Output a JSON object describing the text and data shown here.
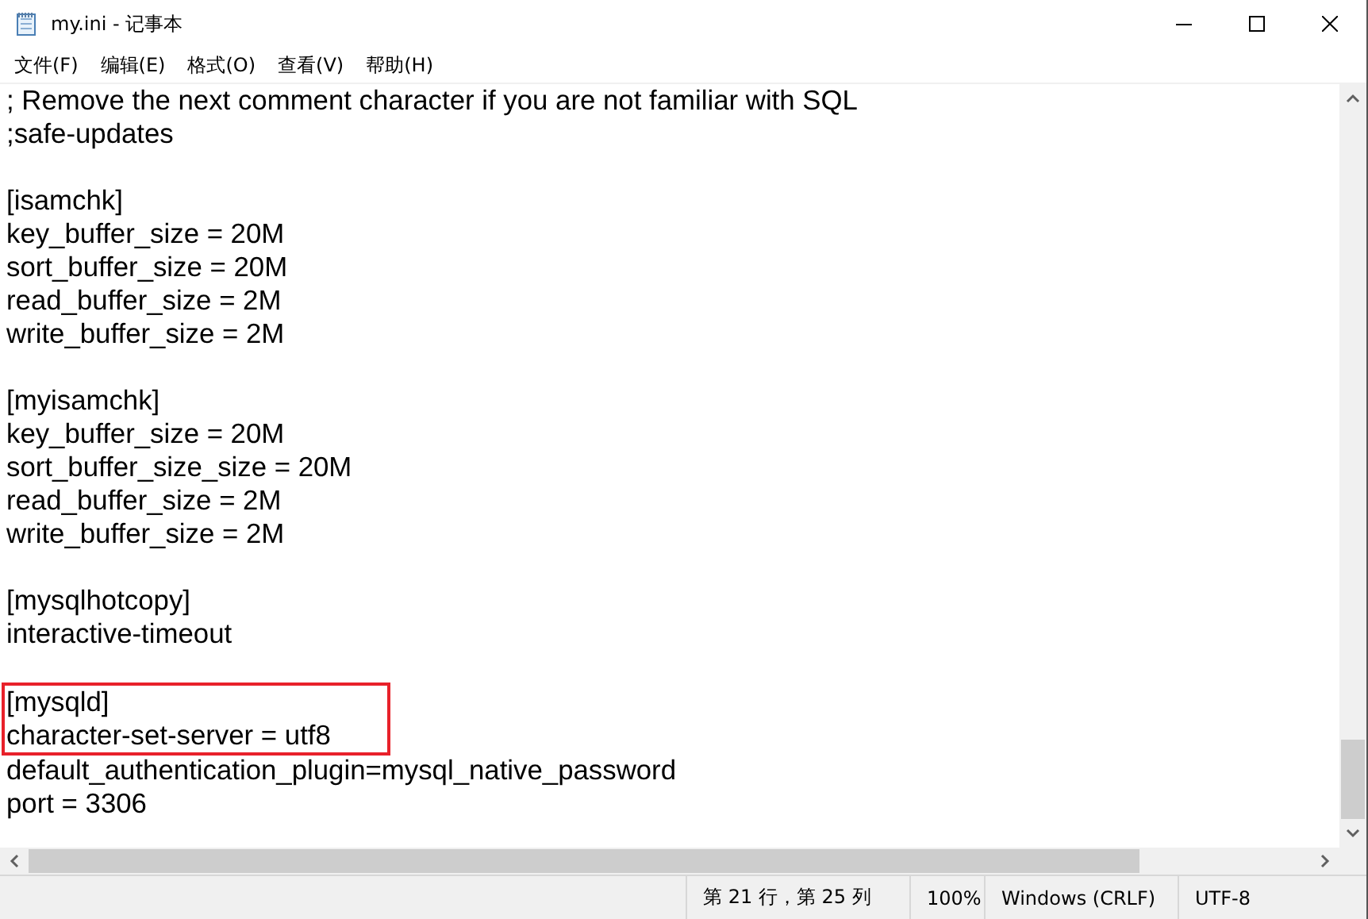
{
  "window": {
    "title": "my.ini - 记事本"
  },
  "menu": [
    "文件(F)",
    "编辑(E)",
    "格式(O)",
    "查看(V)",
    "帮助(H)"
  ],
  "lines": [
    {
      "kind": "text",
      "text": "; Remove the next comment character if you are not familiar with SQL",
      "boxed": false
    },
    {
      "kind": "text",
      "text": ";safe-updates",
      "boxed": false
    },
    {
      "kind": "blank"
    },
    {
      "kind": "text",
      "text": "[isamchk]",
      "boxed": false
    },
    {
      "kind": "text",
      "text": "key_buffer_size = 20M",
      "boxed": false
    },
    {
      "kind": "text",
      "text": "sort_buffer_size = 20M",
      "boxed": false
    },
    {
      "kind": "text",
      "text": "read_buffer_size = 2M",
      "boxed": false
    },
    {
      "kind": "text",
      "text": "write_buffer_size = 2M",
      "boxed": false
    },
    {
      "kind": "blank"
    },
    {
      "kind": "text",
      "text": "[myisamchk]",
      "boxed": false
    },
    {
      "kind": "text",
      "text": "key_buffer_size = 20M",
      "boxed": false
    },
    {
      "kind": "text",
      "text": "sort_buffer_size_size = 20M",
      "boxed": false
    },
    {
      "kind": "text",
      "text": "read_buffer_size = 2M",
      "boxed": false
    },
    {
      "kind": "text",
      "text": "write_buffer_size = 2M",
      "boxed": false
    },
    {
      "kind": "blank"
    },
    {
      "kind": "text",
      "text": "[mysqlhotcopy]",
      "boxed": false
    },
    {
      "kind": "text",
      "text": "interactive-timeout",
      "boxed": false
    },
    {
      "kind": "blank"
    },
    {
      "kind": "text",
      "text": "[mysqld]",
      "boxed": true
    },
    {
      "kind": "text",
      "text": "character-set-server = utf8",
      "boxed": true
    },
    {
      "kind": "text",
      "text": "default_authentication_plugin=mysql_native_password",
      "boxed": false
    },
    {
      "kind": "text",
      "text": "port = 3306",
      "boxed": false
    }
  ],
  "status_bar": {
    "position": "第 21 行，第 25 列",
    "zoom": "100%",
    "line_ending": "Windows (CRLF)",
    "encoding": "UTF-8"
  }
}
